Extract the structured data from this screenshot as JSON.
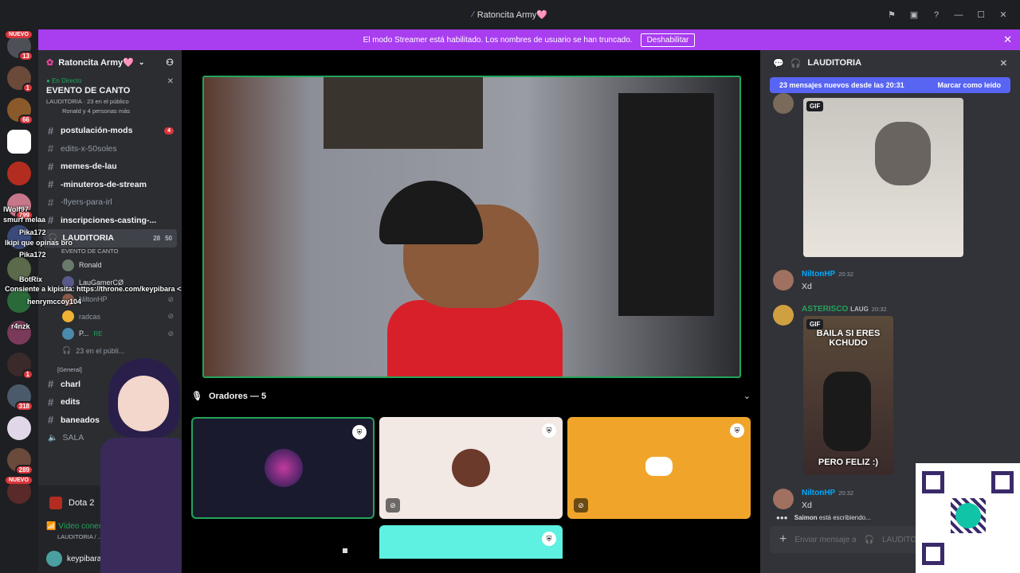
{
  "titlebar": {
    "title": "Ratoncita Army🩷"
  },
  "banner": {
    "text": "El modo Streamer está habilitado. Los nombres de usuario se han truncado.",
    "button": "Deshabilitar"
  },
  "guilds": {
    "nuevo": "NUEVO",
    "nuevo2": "NUEVO",
    "badges": [
      "13",
      "1",
      "66",
      "799",
      "1",
      "318",
      "289"
    ]
  },
  "sidebar": {
    "server_name": "Ratoncita Army🩷",
    "live_label": "En Directo",
    "event_title": "EVENTO DE CANTO",
    "event_meta": "LAUDITORIA · 23 en el público",
    "event_people": "Ronald y 4 personas más",
    "channels": [
      {
        "label": "postulación-mods",
        "count": "4"
      },
      {
        "label": "edits-x-50soles"
      },
      {
        "label": "memes-de-lau"
      },
      {
        "label": "-minuteros-de-stream"
      },
      {
        "label": "-flyers-para-irl"
      },
      {
        "label": "inscripciones-casting-..."
      }
    ],
    "voice_channel": {
      "label": "LAUDITORIA",
      "n1": "28",
      "n2": "50",
      "sub": "EVENTO DE CANTO"
    },
    "voice_users": [
      "Ronald",
      "LauGamerCØ",
      "NiltonHP",
      "radcas",
      "P...",
      "23 en el públi..."
    ],
    "voice_user_tag": "RE",
    "category": "[General]",
    "channels2": [
      {
        "label": "charl"
      },
      {
        "label": "edits"
      },
      {
        "label": "baneados"
      },
      {
        "label": "SALA"
      }
    ],
    "dota": "Dota 2",
    "voice_connected": "Vídeo conectad",
    "voice_connected_sub": "LAUDITORIA / ...",
    "username": "keypibara"
  },
  "stream_overlay": {
    "lines": [
      "lWolf97",
      "smurf melaa",
      "Pika172",
      "lkipi que opinas bro",
      "Pika172",
      "BotRix",
      "Consiente a kipisita: https://throne.com/keypibara <3",
      "henrymccoy104",
      "r4nzk"
    ]
  },
  "stage": {
    "speakers_label": "Oradores — 5"
  },
  "chat": {
    "channel": "LAUDITORIA",
    "new_messages": "23 mensajes nuevos desde las 20:31",
    "mark_read": "Marcar como leído",
    "gif_label": "GIF",
    "messages": [
      {
        "name": "NiltonHP",
        "time": "20:32",
        "text": "Xd",
        "color": "#00a8fc"
      },
      {
        "name": "ASTERISCO",
        "tag": "LAUG",
        "time": "20:32",
        "color": "#23a55a"
      },
      {
        "name": "NiltonHP",
        "time": "20:32",
        "text": "Xd",
        "color": "#00a8fc"
      }
    ],
    "gif_text_top": "BAILA SI ERES KCHUDO",
    "gif_text_bottom": "PERO FELIZ :)",
    "typing_user": "Saimon",
    "typing_rest": "está escribiendo...",
    "input_placeholder": "Enviar mensaje a",
    "input_channel": "LAUDITO"
  }
}
